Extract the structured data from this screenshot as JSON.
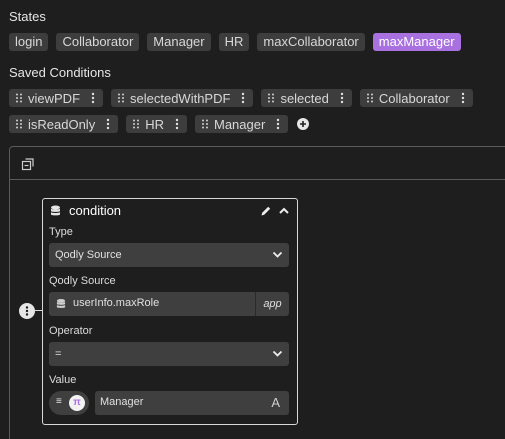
{
  "states": {
    "title": "States",
    "items": [
      {
        "label": "login",
        "active": false
      },
      {
        "label": "Collaborator",
        "active": false
      },
      {
        "label": "Manager",
        "active": false
      },
      {
        "label": "HR",
        "active": false
      },
      {
        "label": "maxCollaborator",
        "active": false
      },
      {
        "label": "maxManager",
        "active": true
      }
    ]
  },
  "saved_conditions": {
    "title": "Saved Conditions",
    "row1": [
      "viewPDF",
      "selectedWithPDF",
      "selected",
      "Collaborator"
    ],
    "row2": [
      "isReadOnly",
      "HR",
      "Manager"
    ]
  },
  "condition_node": {
    "title": "condition",
    "type_label": "Type",
    "type_value": "Qodly Source",
    "source_label": "Qodly Source",
    "source_value": "userInfo.maxRole",
    "source_scope": "app",
    "operator_label": "Operator",
    "operator_value": "=",
    "value_label": "Value",
    "value_mode_left": "≡",
    "value_mode_right": "π",
    "value": "Manager",
    "value_type_icon": "A"
  },
  "colors": {
    "accent": "#a970e0",
    "background": "#1e1e1e",
    "chip": "#3d3d3d"
  },
  "icons": {
    "grip": "drag-grip-icon",
    "kebab": "kebab-menu-icon",
    "add": "plus-circle-icon",
    "collapse": "collapse-all-icon",
    "database": "database-icon",
    "edit": "pencil-icon",
    "collapse_node": "chevron-up-icon",
    "dropdown": "chevron-down-icon"
  }
}
